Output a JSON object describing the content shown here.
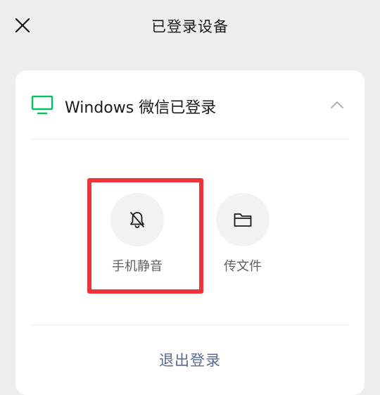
{
  "header": {
    "title": "已登录设备",
    "close_icon": "close-icon"
  },
  "device": {
    "icon": "monitor-icon",
    "label": "Windows 微信已登录",
    "toggle_icon": "chevron-up-icon",
    "expanded": true
  },
  "actions": [
    {
      "icon": "bell-off-icon",
      "label": "手机静音",
      "highlighted": true
    },
    {
      "icon": "folder-icon",
      "label": "传文件",
      "highlighted": false
    }
  ],
  "logout_label": "退出登录",
  "colors": {
    "background": "#ededed",
    "card": "#ffffff",
    "monitor_green": "#07c160",
    "link_blue": "#576b95",
    "highlight_red": "#ee3438"
  }
}
